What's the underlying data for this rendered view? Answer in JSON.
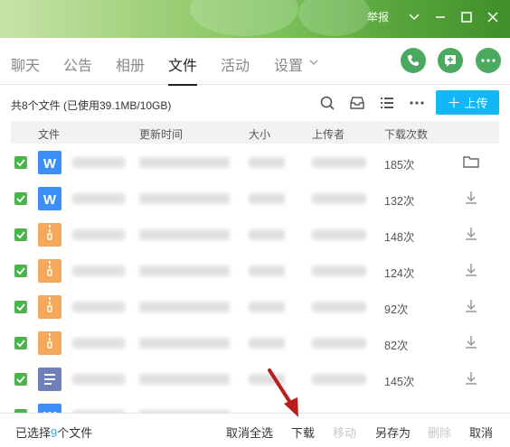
{
  "titlebar": {
    "report": "举报"
  },
  "tabs": [
    "聊天",
    "公告",
    "相册",
    "文件",
    "活动",
    "设置"
  ],
  "info": {
    "summary": "共8个文件 (已使用39.1MB/10GB)"
  },
  "toolbar": {
    "upload_label": "上传",
    "upload_plus": "＋"
  },
  "table": {
    "headers": {
      "file": "文件",
      "updated": "更新时间",
      "size": "大小",
      "uploader": "上传者",
      "downloads": "下载次数"
    },
    "rows": [
      {
        "type": "word",
        "downloads": "185次",
        "action": "folder-icon"
      },
      {
        "type": "word",
        "downloads": "132次",
        "action": "download-icon"
      },
      {
        "type": "zip",
        "downloads": "148次",
        "action": "download-icon"
      },
      {
        "type": "zip",
        "downloads": "124次",
        "action": "download-icon"
      },
      {
        "type": "zip",
        "downloads": "92次",
        "action": "download-icon"
      },
      {
        "type": "zip",
        "downloads": "82次",
        "action": "download-icon"
      },
      {
        "type": "doc",
        "downloads": "145次",
        "action": "download-icon"
      }
    ]
  },
  "bottom": {
    "selected_prefix": "已选择",
    "selected_count": "9",
    "selected_suffix": "个文件",
    "deselect_all": "取消全选",
    "download": "下载",
    "move": "移动",
    "save_as": "另存为",
    "delete": "删除",
    "cancel": "取消"
  },
  "colors": {
    "accent": "#12b7f5",
    "check": "#4bb54b",
    "titlebar": "#7bc15a",
    "word": "#3e8ef7",
    "zip": "#f5a75a"
  }
}
